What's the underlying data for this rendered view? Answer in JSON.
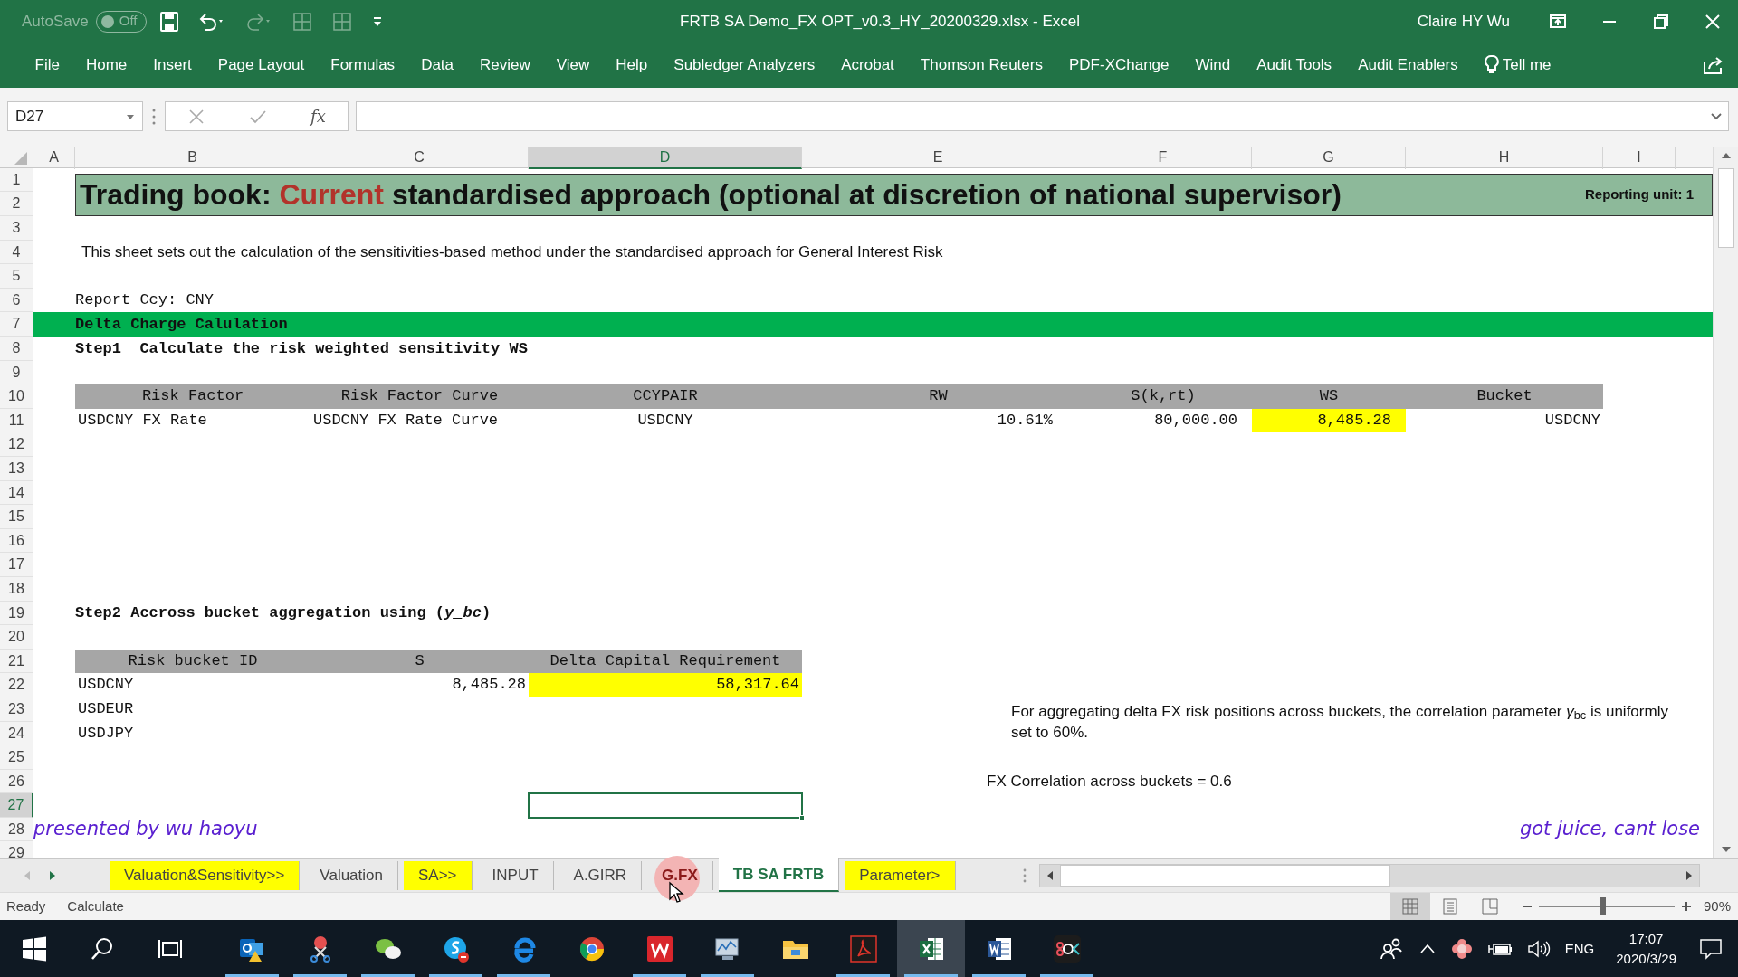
{
  "title_bar": {
    "autosave": {
      "label": "AutoSave",
      "state": "Off",
      "on": false
    },
    "document_title": "FRTB SA Demo_FX OPT_v0.3_HY_20200329.xlsx  -  Excel",
    "user": "Claire HY Wu"
  },
  "ribbon_tabs": [
    "File",
    "Home",
    "Insert",
    "Page Layout",
    "Formulas",
    "Data",
    "Review",
    "View",
    "Help",
    "Subledger Analyzers",
    "Acrobat",
    "Thomson Reuters",
    "PDF-XChange",
    "Wind",
    "Audit Tools",
    "Audit Enablers"
  ],
  "tell_me": "Tell me",
  "formula_bar": {
    "name_box": "D27",
    "function_label": "fx"
  },
  "column_headers": [
    {
      "label": "A",
      "selected": false
    },
    {
      "label": "B",
      "selected": false
    },
    {
      "label": "C",
      "selected": false
    },
    {
      "label": "D",
      "selected": true
    },
    {
      "label": "E",
      "selected": false
    },
    {
      "label": "F",
      "selected": false
    },
    {
      "label": "G",
      "selected": false
    },
    {
      "label": "H",
      "selected": false
    },
    {
      "label": "I",
      "selected": false
    }
  ],
  "row_headers": [
    {
      "label": "1",
      "selected": false
    },
    {
      "label": "2",
      "selected": false
    },
    {
      "label": "3",
      "selected": false
    },
    {
      "label": "4",
      "selected": false
    },
    {
      "label": "5",
      "selected": false
    },
    {
      "label": "6",
      "selected": false
    },
    {
      "label": "7",
      "selected": false
    },
    {
      "label": "8",
      "selected": false
    },
    {
      "label": "9",
      "selected": false
    },
    {
      "label": "10",
      "selected": false
    },
    {
      "label": "11",
      "selected": false
    },
    {
      "label": "12",
      "selected": false
    },
    {
      "label": "13",
      "selected": false
    },
    {
      "label": "14",
      "selected": false
    },
    {
      "label": "15",
      "selected": false
    },
    {
      "label": "16",
      "selected": false
    },
    {
      "label": "17",
      "selected": false
    },
    {
      "label": "18",
      "selected": false
    },
    {
      "label": "19",
      "selected": false
    },
    {
      "label": "20",
      "selected": false
    },
    {
      "label": "21",
      "selected": false
    },
    {
      "label": "22",
      "selected": false
    },
    {
      "label": "23",
      "selected": false
    },
    {
      "label": "24",
      "selected": false
    },
    {
      "label": "25",
      "selected": false
    },
    {
      "label": "26",
      "selected": false
    },
    {
      "label": "27",
      "selected": true
    },
    {
      "label": "28",
      "selected": false
    },
    {
      "label": "29",
      "selected": false
    }
  ],
  "sheet": {
    "title": {
      "before": "Trading book: ",
      "highlight": "Current",
      "after": " standardised approach (optional at discretion of national supervisor)"
    },
    "reporting_unit": "Reporting unit: 1",
    "description": "This sheet sets out the calculation of the sensitivities-based method under the standardised approach for General Interest Risk",
    "report_ccy": "Report Ccy: CNY",
    "section": "Delta Charge Calulation",
    "step1": {
      "heading": "Step1  Calculate the risk weighted sensitivity WS",
      "columns": [
        "Risk Factor",
        "Risk Factor Curve",
        "CCYPAIR",
        "RW",
        "S(k,rt)",
        "WS",
        "Bucket"
      ],
      "rows": [
        {
          "cells": [
            {
              "text": "USDCNY FX Rate",
              "highlight": false
            },
            {
              "text": "USDCNY FX Rate Curve",
              "highlight": false
            },
            {
              "text": "USDCNY",
              "highlight": false
            },
            {
              "text": "10.61%",
              "highlight": false
            },
            {
              "text": "80,000.00",
              "highlight": false
            },
            {
              "text": "8,485.28",
              "highlight": true
            },
            {
              "text": "USDCNY",
              "highlight": false
            }
          ]
        }
      ]
    },
    "step2": {
      "heading": "Step2 Accross bucket aggregation using (*y_bc*)",
      "columns": [
        "Risk bucket ID",
        "S",
        "Delta Capital Requirement"
      ],
      "rows": [
        {
          "cells": [
            {
              "text": "USDCNY",
              "highlight": false
            },
            {
              "text": "8,485.28",
              "highlight": false
            },
            {
              "text": "58,317.64",
              "highlight": true
            }
          ]
        },
        {
          "cells": [
            {
              "text": "USDEUR",
              "highlight": false
            }
          ]
        },
        {
          "cells": [
            {
              "text": "USDJPY",
              "highlight": false
            }
          ]
        }
      ]
    },
    "note": "For aggregating delta FX risk positions across buckets, the correlation parameter *γ*$_{bc}$ is uniformly set to 60%.",
    "correlation": "FX Correlation across buckets = 0.6",
    "captions": {
      "left": "presented by wu haoyu",
      "right": "got juice, cant lose"
    }
  },
  "sheet_tabs": [
    {
      "label": "Valuation&Sensitivity>>",
      "color": "#ffff00",
      "selected": false,
      "pressed": false
    },
    {
      "label": "Valuation",
      "selected": false,
      "pressed": false
    },
    {
      "label": "SA>>",
      "color": "#ffff00",
      "selected": false,
      "pressed": false
    },
    {
      "label": "INPUT",
      "selected": false,
      "pressed": false
    },
    {
      "label": "A.GIRR",
      "selected": false,
      "pressed": false
    },
    {
      "label": "G.FX",
      "selected": false,
      "pressed": true
    },
    {
      "label": "TB SA FRTB",
      "selected": true,
      "pressed": false
    },
    {
      "label": "Parameter>",
      "color": "#ffff00",
      "selected": false,
      "pressed": false
    }
  ],
  "status_bar": {
    "mode": "Ready",
    "calculate": "Calculate",
    "views": [
      {
        "selected": true
      },
      {
        "selected": false
      },
      {
        "selected": false
      }
    ],
    "zoom": {
      "level": 0.47,
      "label": "90%"
    }
  },
  "taskbar": {
    "apps": [
      {
        "running": true,
        "active": false
      },
      {
        "running": true,
        "active": false
      },
      {
        "running": true,
        "active": false
      },
      {
        "running": true,
        "active": false
      },
      {
        "running": true,
        "active": false
      },
      {
        "running": false,
        "active": false
      },
      {
        "running": true,
        "active": false
      },
      {
        "running": true,
        "active": false
      },
      {
        "running": false,
        "active": false
      },
      {
        "running": true,
        "active": false
      },
      {
        "running": true,
        "active": true
      },
      {
        "running": true,
        "active": false
      },
      {
        "running": true,
        "active": false
      }
    ],
    "language": "ENG",
    "time": "17:07",
    "date": "2020/3/29"
  }
}
